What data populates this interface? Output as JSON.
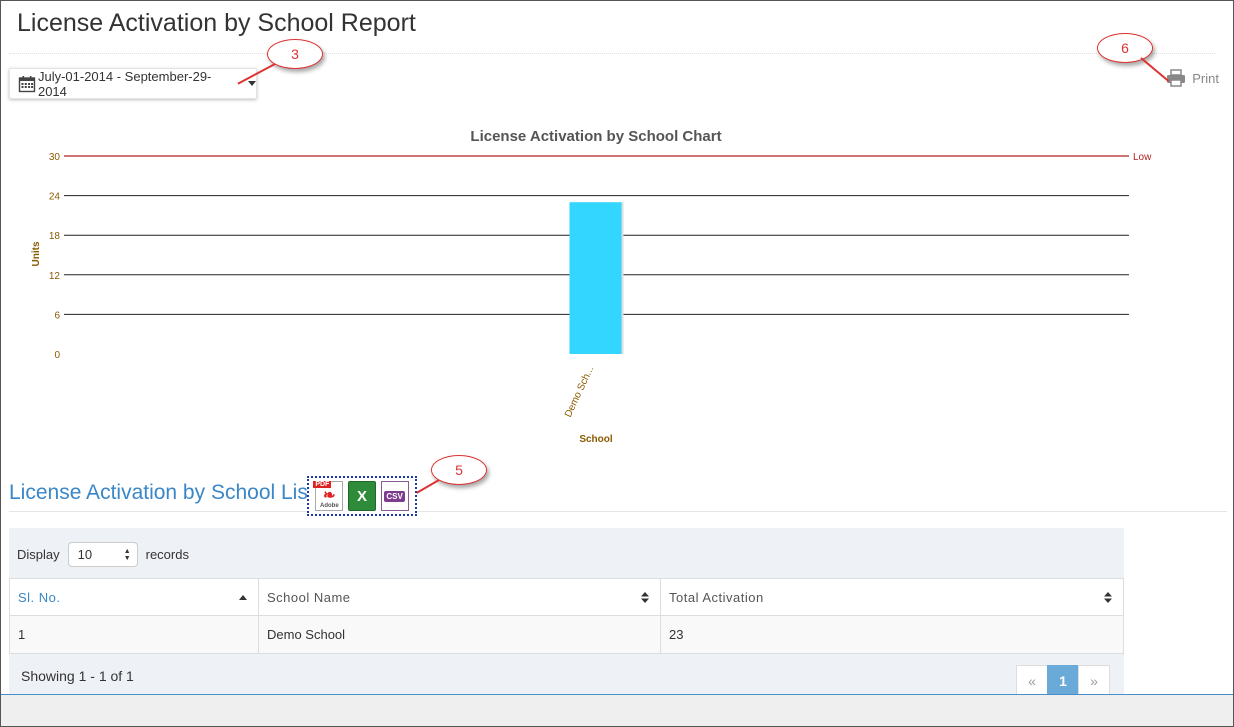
{
  "header": {
    "title": "License Activation by School Report"
  },
  "date_range": {
    "label": "July-01-2014 - September-29-2014",
    "icon": "calendar-icon"
  },
  "print": {
    "label": "Print",
    "icon": "printer-icon"
  },
  "callouts": {
    "date": "3",
    "print": "6",
    "export": "5"
  },
  "chart_data": {
    "type": "bar",
    "title": "License Activation by School Chart",
    "xlabel": "School",
    "ylabel": "Units",
    "categories": [
      "Demo Sch..."
    ],
    "values": [
      23
    ],
    "ylim": [
      0,
      30
    ],
    "yticks": [
      0,
      6,
      12,
      18,
      24,
      30
    ],
    "threshold": {
      "value": 30,
      "label": "Low",
      "color": "#b22222"
    },
    "bar_color": "#33d6ff",
    "grid": true
  },
  "list": {
    "title": "License Activation by School List",
    "exports": {
      "pdf_tag": "PDF",
      "pdf_sub": "Adobe",
      "xls_glyph": "X",
      "csv_tag": "CSV"
    }
  },
  "table": {
    "display_label": "Display",
    "page_size": "10",
    "records_label": "records",
    "columns": [
      "Sl. No.",
      "School Name",
      "Total Activation"
    ],
    "rows": [
      [
        "1",
        "Demo School",
        "23"
      ]
    ],
    "showing": "Showing 1 - 1 of 1",
    "pager": {
      "prev": "«",
      "current": "1",
      "next": "»"
    }
  },
  "colors": {
    "accent": "#3a87c8",
    "callout": "#dd3333",
    "axis_text": "#8b5a00"
  }
}
